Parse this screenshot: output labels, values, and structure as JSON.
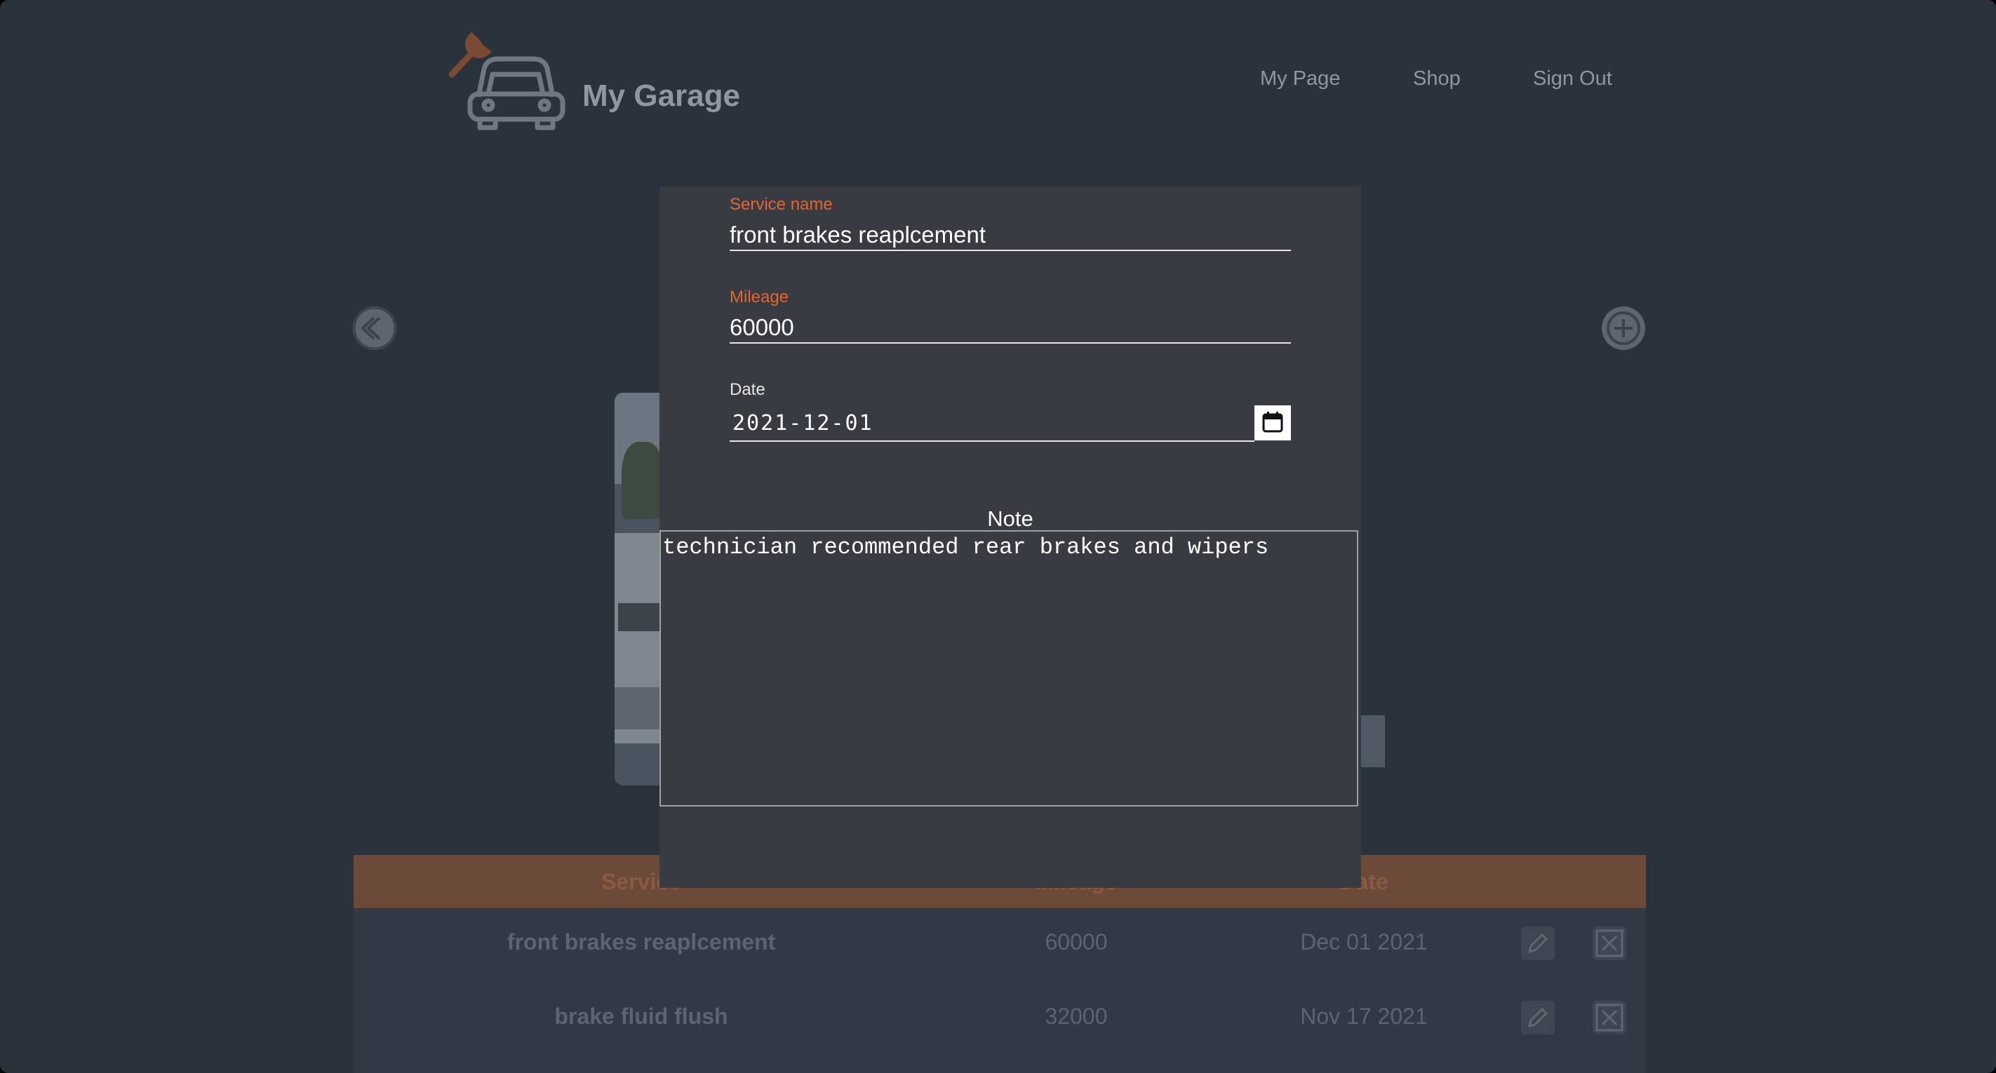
{
  "header": {
    "brand": "My Garage",
    "nav": [
      "My Page",
      "Shop",
      "Sign Out"
    ]
  },
  "icons": {
    "logo": "car-wrench-icon",
    "prev": "chevron-left-icon",
    "add": "plus-icon",
    "calendar": "calendar-icon",
    "edit": "pencil-icon",
    "delete": "close-icon"
  },
  "colors": {
    "accent": "#e2662f",
    "background": "#2a323c",
    "modal": "#383c42",
    "table_header": "#6b4a3a"
  },
  "modal": {
    "service_name": {
      "label": "Service name",
      "value": "front brakes reaplcement"
    },
    "mileage": {
      "label": "Mileage",
      "value": "60000"
    },
    "date": {
      "label": "Date",
      "value": "2021-12-01"
    },
    "note": {
      "label": "Note",
      "value": "technician recommended rear brakes and wipers"
    }
  },
  "table": {
    "columns": [
      "Service",
      "Mileage",
      "Date"
    ],
    "rows": [
      {
        "service": "front brakes reaplcement",
        "mileage": "60000",
        "date": "Dec 01 2021"
      },
      {
        "service": "brake fluid flush",
        "mileage": "32000",
        "date": "Nov 17 2021"
      }
    ]
  }
}
